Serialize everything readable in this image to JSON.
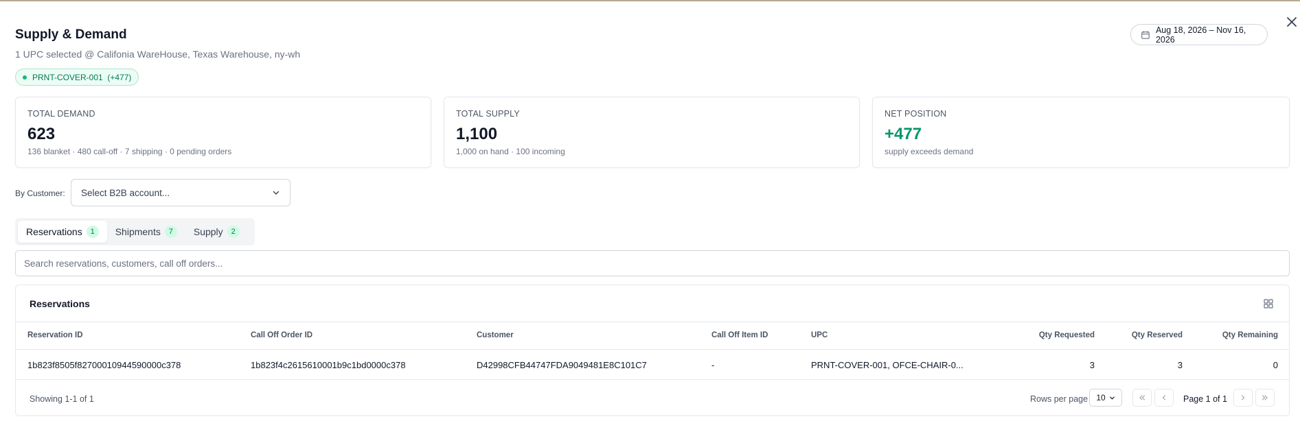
{
  "header": {
    "title": "Supply & Demand",
    "subtitle": "1 UPC selected @ Califonia WareHouse, Texas Warehouse, ny-wh",
    "date_range": "Aug 18, 2026 – Nov 16, 2026",
    "chip_label": "PRNT-COVER-001  (+477)"
  },
  "cards": [
    {
      "label": "TOTAL DEMAND",
      "value": "623",
      "sub": "136 blanket · 480 call-off · 7 shipping · 0 pending orders"
    },
    {
      "label": "TOTAL SUPPLY",
      "value": "1,100",
      "sub": "1,000 on hand · 100 incoming"
    },
    {
      "label": "NET POSITION",
      "value": "+477",
      "sub": "supply exceeds demand"
    }
  ],
  "filter": {
    "label": "By Customer:",
    "placeholder": "Select B2B account..."
  },
  "tabs": [
    {
      "label": "Reservations",
      "count": "1"
    },
    {
      "label": "Shipments",
      "count": "7"
    },
    {
      "label": "Supply",
      "count": "2"
    }
  ],
  "search": {
    "placeholder": "Search reservations, customers, call off orders..."
  },
  "table": {
    "title": "Reservations",
    "columns": [
      "Reservation ID",
      "Call Off Order ID",
      "Customer",
      "Call Off Item ID",
      "UPC",
      "Qty Requested",
      "Qty Reserved",
      "Qty Remaining"
    ],
    "rows": [
      [
        "1b823f8505f82700010944590000c378",
        "1b823f4c2615610001b9c1bd0000c378",
        "D42998CFB44747FDA9049481E8C101C7",
        "-",
        "PRNT-COVER-001, OFCE-CHAIR-0...",
        "3",
        "3",
        "0"
      ]
    ]
  },
  "pagination": {
    "showing": "Showing 1-1 of 1",
    "rows_per_page_label": "Rows per page",
    "rows_per_page": "10",
    "page_info": "Page 1 of 1"
  },
  "colors": {
    "accent_green": "#059669",
    "chip_bg": "#ecfdf5",
    "badge_bg": "#d1fae5"
  }
}
